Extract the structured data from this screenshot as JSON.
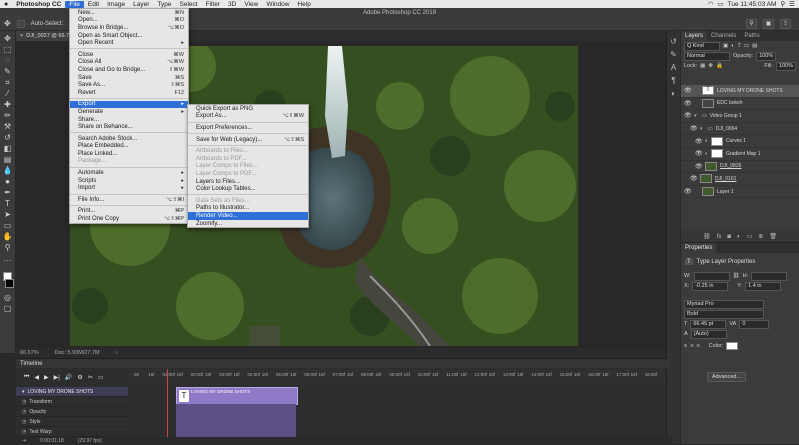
{
  "menubar": {
    "app_name": "Photoshop CC",
    "items": [
      "File",
      "Edit",
      "Image",
      "Layer",
      "Type",
      "Select",
      "Filter",
      "3D",
      "View",
      "Window",
      "Help"
    ],
    "clock": "Tue 11:45:03 AM"
  },
  "titlebar": {
    "title": "Adobe Photoshop CC 2019"
  },
  "optionsbar": {
    "auto_select_label": "Auto-Select:"
  },
  "document": {
    "tab_label": "DJI_0027 @ 66.7% (LOVING MY DRONE SHOTS, RGB/8) *",
    "zoom": "66.67%",
    "doc_size": "Doc: 5.93M/27.7M"
  },
  "file_menu": {
    "items": [
      {
        "label": "New...",
        "shortcut": "⌘N"
      },
      {
        "label": "Open...",
        "shortcut": "⌘O"
      },
      {
        "label": "Browse in Bridge...",
        "shortcut": "⌥⌘O"
      },
      {
        "label": "Open as Smart Object...",
        "shortcut": ""
      },
      {
        "label": "Open Recent",
        "shortcut": "▸"
      },
      {
        "sep": true
      },
      {
        "label": "Close",
        "shortcut": "⌘W"
      },
      {
        "label": "Close All",
        "shortcut": "⌥⌘W"
      },
      {
        "label": "Close and Go to Bridge...",
        "shortcut": "⇧⌘W"
      },
      {
        "label": "Save",
        "shortcut": "⌘S"
      },
      {
        "label": "Save As...",
        "shortcut": "⇧⌘S"
      },
      {
        "label": "Revert",
        "shortcut": "F12"
      },
      {
        "sep": true
      },
      {
        "label": "Export",
        "shortcut": "▸",
        "highlight": true
      },
      {
        "label": "Generate",
        "shortcut": "▸"
      },
      {
        "label": "Share...",
        "shortcut": ""
      },
      {
        "label": "Share on Behance...",
        "shortcut": ""
      },
      {
        "sep": true
      },
      {
        "label": "Search Adobe Stock...",
        "shortcut": ""
      },
      {
        "label": "Place Embedded...",
        "shortcut": ""
      },
      {
        "label": "Place Linked...",
        "shortcut": ""
      },
      {
        "label": "Package...",
        "shortcut": "",
        "disabled": true
      },
      {
        "sep": true
      },
      {
        "label": "Automate",
        "shortcut": "▸"
      },
      {
        "label": "Scripts",
        "shortcut": "▸"
      },
      {
        "label": "Import",
        "shortcut": "▸"
      },
      {
        "sep": true
      },
      {
        "label": "File Info...",
        "shortcut": "⌥⇧⌘I"
      },
      {
        "sep": true
      },
      {
        "label": "Print...",
        "shortcut": "⌘P"
      },
      {
        "label": "Print One Copy",
        "shortcut": "⌥⇧⌘P"
      }
    ]
  },
  "export_menu": {
    "items": [
      {
        "label": "Quick Export as PNG",
        "shortcut": ""
      },
      {
        "label": "Export As...",
        "shortcut": "⌥⇧⌘W"
      },
      {
        "sep": true
      },
      {
        "label": "Export Preferences...",
        "shortcut": ""
      },
      {
        "sep": true
      },
      {
        "label": "Save for Web (Legacy)...",
        "shortcut": "⌥⇧⌘S"
      },
      {
        "sep": true
      },
      {
        "label": "Artboards to Files...",
        "shortcut": "",
        "disabled": true
      },
      {
        "label": "Artboards to PDF...",
        "shortcut": "",
        "disabled": true
      },
      {
        "label": "Layer Comps to Files...",
        "shortcut": "",
        "disabled": true
      },
      {
        "label": "Layer Comps to PDF...",
        "shortcut": "",
        "disabled": true
      },
      {
        "label": "Layers to Files...",
        "shortcut": ""
      },
      {
        "label": "Color Lookup Tables...",
        "shortcut": ""
      },
      {
        "sep": true
      },
      {
        "label": "Data Sets as Files...",
        "shortcut": "",
        "disabled": true
      },
      {
        "label": "Paths to Illustrator...",
        "shortcut": ""
      },
      {
        "label": "Render Video...",
        "shortcut": "",
        "highlight": true
      },
      {
        "label": "Zoomify...",
        "shortcut": ""
      }
    ]
  },
  "layers_panel": {
    "tabs": [
      "Layers",
      "Channels",
      "Paths"
    ],
    "kind_label": "Q Kind",
    "blend_mode": "Normal",
    "opacity_label": "Opacity:",
    "opacity_value": "100%",
    "lock_label": "Lock:",
    "fill_label": "Fill:",
    "fill_value": "100%",
    "layers": [
      {
        "name": "LOVING MY DRONE SHOTS",
        "thumb": "text",
        "selected": true
      },
      {
        "name": "EDC bokeh",
        "thumb": "dark"
      },
      {
        "name": "Video Group 1",
        "thumb": "folder"
      },
      {
        "name": "DJI_0064",
        "thumb": "folder"
      },
      {
        "name": "Curves 1",
        "thumb": "white"
      },
      {
        "name": "Gradient Map 1",
        "thumb": "white"
      },
      {
        "name": "DJI_0826",
        "thumb": "img"
      },
      {
        "name": "DJI_0161",
        "thumb": "img"
      },
      {
        "name": "Layer 1",
        "thumb": "img"
      }
    ]
  },
  "properties_panel": {
    "title": "Properties",
    "subtitle": "Type Layer Properties",
    "w_label": "W:",
    "h_label": "H:",
    "x_label": "X:",
    "x_value": "-0.25 in",
    "y_label": "Y:",
    "y_value": "1.4 in",
    "font_family": "Myriad Pro",
    "font_style": "Bold",
    "font_size": "66.45 pt",
    "tracking": "0",
    "leading": "(Auto)",
    "color_label": "Color:",
    "advanced_button": "Advanced..."
  },
  "timeline": {
    "title": "Timeline",
    "ruler_ticks": [
      "00",
      "15f",
      "01:00f",
      "15f",
      "02:00f",
      "15f",
      "03:00f",
      "15f",
      "04:00f",
      "15f",
      "05:00f",
      "15f",
      "06:00f",
      "15f",
      "07:00f",
      "15f",
      "08:00f",
      "15f",
      "09:00f",
      "15f",
      "10:00f",
      "15f",
      "11:00f",
      "15f",
      "12:00f",
      "15f",
      "13:00f",
      "15f",
      "14:00f",
      "15f",
      "15:00f",
      "15f",
      "16:00f",
      "15f",
      "17:00f",
      "15f",
      "18:00f"
    ],
    "track_name": "LOVING MY DRONE SHOTS",
    "clip_label": "LOVING MY DRONE SHOTS",
    "properties": [
      "Transform",
      "Opacity",
      "Style",
      "Text Warp"
    ],
    "current_time": "0:00:01:18",
    "fps": "(29.97 fps)"
  }
}
